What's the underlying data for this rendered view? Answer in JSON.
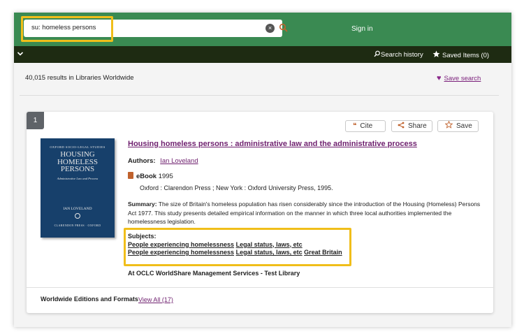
{
  "search": {
    "query": "su: homeless persons",
    "clear_label": "×"
  },
  "header": {
    "signin_label": "Sign in"
  },
  "subbar": {
    "search_history_label": "Search history",
    "saved_items_label": "Saved Items (0)"
  },
  "results": {
    "count_label": "40,015 results in Libraries Worldwide",
    "save_search_label": "Save search"
  },
  "record": {
    "index": "1",
    "actions": {
      "cite": "Cite",
      "share": "Share",
      "save": "Save"
    },
    "cover": {
      "series": "OXFORD SOCIO-LEGAL STUDIES",
      "title_line1": "HOUSING",
      "title_line2": "HOMELESS",
      "title_line3": "PERSONS",
      "subtitle": "Administrative Law and Process",
      "author": "IAN LOVELAND",
      "publisher": "CLARENDON PRESS · OXFORD"
    },
    "title": "Housing homeless persons : administrative law and the administrative process",
    "authors_label": "Authors:",
    "author": "Ian Loveland",
    "format": "eBook",
    "year": "1995",
    "publication": "Oxford : Clarendon Press ; New York : Oxford University Press, 1995.",
    "summary_label": "Summary:",
    "summary": "The size of Britain's homeless population has risen considerably since the introduction of the Housing (Homeless) Persons Act 1977. This study presents detailed empirical information on the manner in which three local authorities implemented the homelessness legislation.",
    "subjects_label": "Subjects:",
    "subject1": {
      "a": "People experiencing homelessness",
      "b": "Legal status, laws, etc"
    },
    "subject2": {
      "a": "People experiencing homelessness",
      "b": "Legal status, laws, etc",
      "c": "Great Britain"
    },
    "library": "At OCLC WorldShare Management Services - Test Library",
    "editions_label": "Worldwide Editions and Formats",
    "view_all_label": "View All (17)"
  },
  "colors": {
    "topbar": "#3a8a52",
    "subbar": "#1e2b12",
    "link": "#6e1f6e",
    "highlight": "#f0be1a",
    "accent": "#c0622d"
  },
  "icons": {
    "search": "magnifier-icon",
    "clear": "clear-icon",
    "history": "history-search-icon",
    "saved": "star-icon",
    "save_search": "heart-icon",
    "cite": "quote-icon",
    "share": "share-icon",
    "save": "star-outline-icon",
    "format": "book-icon"
  }
}
